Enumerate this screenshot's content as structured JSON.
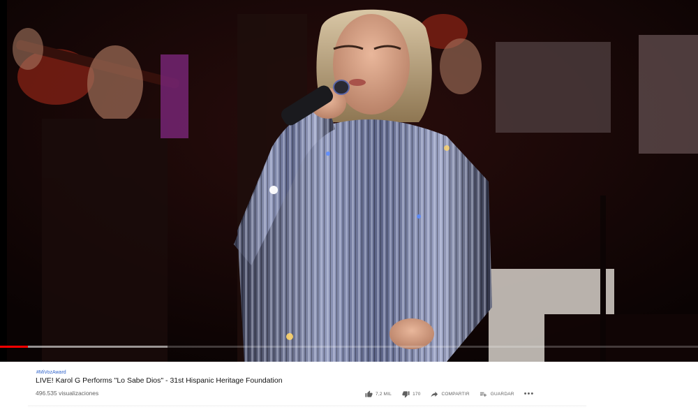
{
  "video": {
    "progress_played": 0.04,
    "progress_buffered": 0.24
  },
  "meta": {
    "hashtag": "#MiVozAward",
    "title": "LIVE! Karol G Performs \"Lo Sabe Dios\" - 31st Hispanic Heritage Foundation",
    "views": "496.535 visualizaciones"
  },
  "actions": {
    "like": {
      "icon": "thumbs-up-icon",
      "label": "7,2 MIL"
    },
    "dislike": {
      "icon": "thumbs-down-icon",
      "label": "170"
    },
    "share": {
      "icon": "share-icon",
      "label": "COMPARTIR"
    },
    "save": {
      "icon": "playlist-add-icon",
      "label": "GUARDAR"
    },
    "more": {
      "icon": "more-horizontal-icon",
      "label": "•••"
    }
  },
  "colors": {
    "progress": "#ff0000",
    "link": "#3366cc",
    "muted": "#606060"
  }
}
